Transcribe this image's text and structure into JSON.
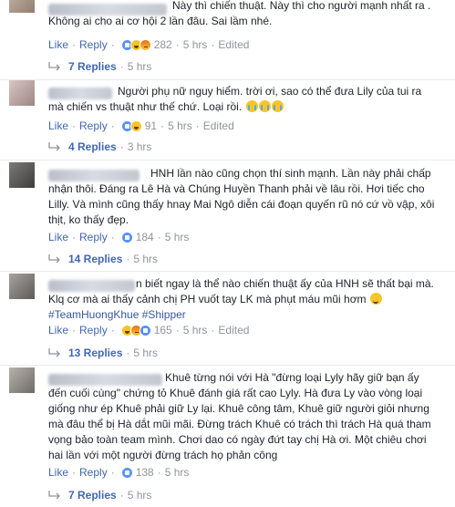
{
  "labels": {
    "like": "Like",
    "reply": "Reply"
  },
  "comments": [
    {
      "text_lines": [
        "Này thì chiến thuật. Này thì cho người mạnh nhất ra .",
        "Không ai cho ai cơ hội 2 lần đâu. Sai lầm nhé."
      ],
      "reaction_count": "282",
      "time": "5 hrs",
      "edited": "Edited",
      "replies": "7 Replies",
      "replies_time": "5 hrs"
    },
    {
      "text_lines": [
        "Người phụ nữ nguy hiểm. trời ơi, sao có thể đưa Lily của tui ra",
        "mà chiến vs thuật như thế chứ. Loại rồi."
      ],
      "reaction_count": "91",
      "time": "5 hrs",
      "edited": "Edited",
      "replies": "4 Replies",
      "replies_time": "3 hrs"
    },
    {
      "text_lines": [
        "HNH lần nào cũng chọn thí sinh mạnh. Lần này phải chấp",
        "nhận thôi. Đáng ra Lê Hà và Chúng Huyền Thanh phải về lâu rồi. Hơi tiếc cho",
        "Lilly. Và mình cũng thấy hnay Mai Ngô diễn cái đoạn quyến rũ nó cứ vồ vập, xôi",
        "thịt, ko thấy đẹp."
      ],
      "reaction_count": "184",
      "time": "5 hrs",
      "replies": "14 Replies",
      "replies_time": "5 hrs"
    },
    {
      "text_lines": [
        "n biết ngay là thể nào chiến thuật ấy của HNH sẽ thất bại mà.",
        "Klq cơ mà ai thấy cảnh chị PH vuốt tay LK mà phụt máu mũi hơm"
      ],
      "hashtags": [
        "#TeamHuongKhue",
        "#Shipper"
      ],
      "reaction_count": "165",
      "time": "5 hrs",
      "edited": "Edited",
      "replies": "13 Replies",
      "replies_time": "5 hrs"
    },
    {
      "text_lines": [
        "Khuê từng nói với Hà \"đừng loại Lyly hãy giữ bạn ấy",
        "đến cuối cùng\" chứng tỏ Khuê đánh giá rất cao Lyly. Hà đưa Ly vào vòng loại",
        "giống như ép Khuê phải giữ Ly lại. Khuê công tâm, Khuê giữ người giỏi nhưng",
        "mà đâu thể bị Hà dắt mũi mãi. Đừng trách Khuê có trách thì trách Hà quá tham",
        "vọng bảo toàn team mình. Chơi dao có ngày đứt tay chị Hà ơi. Một chiêu chơi",
        "hai lần với một người đừng trách họ phản công"
      ],
      "reaction_count": "138",
      "time": "5 hrs",
      "replies": "7 Replies",
      "replies_time": "5 hrs"
    }
  ]
}
